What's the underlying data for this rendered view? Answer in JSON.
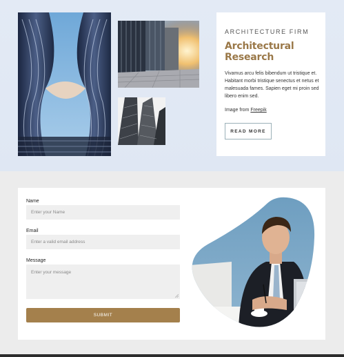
{
  "hero": {
    "eyebrow": "ARCHITECTURE FIRM",
    "title": "Architectural Research",
    "body": "Vivamus arcu felis bibendum ut tristique et. Habitant morbi tristique senectus et netus et malesuada fames. Sapien eget mi proin sed libero enim sed.",
    "credit_prefix": "Image from ",
    "credit_link": "Freepik",
    "read_more_label": "READ MORE"
  },
  "form": {
    "name_label": "Name",
    "name_placeholder": "Enter your Name",
    "email_label": "Email",
    "email_placeholder": "Enter a valid email address",
    "message_label": "Message",
    "message_placeholder": "Enter your message",
    "submit_label": "SUBMIT"
  },
  "colors": {
    "accent": "#a4804c",
    "title_gold": "#9a7848",
    "hero_bg": "#e3eaf5",
    "page_bg": "#ececec"
  }
}
